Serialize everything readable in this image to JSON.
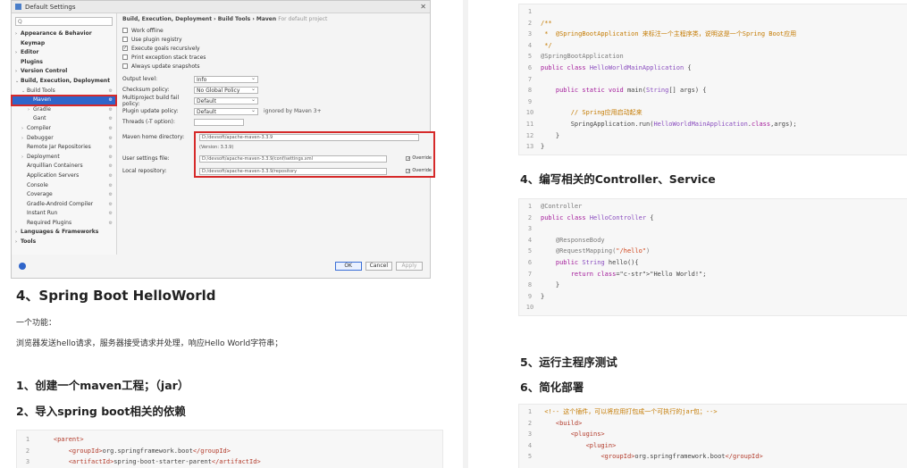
{
  "dialog": {
    "title": "Default Settings",
    "search_placeholder": "Q",
    "tree": [
      {
        "label": "Appearance & Behavior",
        "arrow": "›",
        "bold": true,
        "indent": 0
      },
      {
        "label": "Keymap",
        "arrow": "",
        "bold": true,
        "indent": 0
      },
      {
        "label": "Editor",
        "arrow": "›",
        "bold": true,
        "indent": 0
      },
      {
        "label": "Plugins",
        "arrow": "",
        "bold": true,
        "indent": 0
      },
      {
        "label": "Version Control",
        "arrow": "›",
        "bold": true,
        "indent": 0
      },
      {
        "label": "Build, Execution, Deployment",
        "arrow": "⌄",
        "bold": true,
        "indent": 0
      },
      {
        "label": "Build Tools",
        "arrow": "⌄",
        "bold": false,
        "indent": 1
      },
      {
        "label": "Maven",
        "arrow": "",
        "bold": false,
        "indent": 2,
        "selected": true
      },
      {
        "label": "Gradle",
        "arrow": "›",
        "bold": false,
        "indent": 2
      },
      {
        "label": "Gant",
        "arrow": "",
        "bold": false,
        "indent": 2
      },
      {
        "label": "Compiler",
        "arrow": "›",
        "bold": false,
        "indent": 1
      },
      {
        "label": "Debugger",
        "arrow": "›",
        "bold": false,
        "indent": 1
      },
      {
        "label": "Remote Jar Repositories",
        "arrow": "",
        "bold": false,
        "indent": 1
      },
      {
        "label": "Deployment",
        "arrow": "›",
        "bold": false,
        "indent": 1
      },
      {
        "label": "Arquillian Containers",
        "arrow": "",
        "bold": false,
        "indent": 1
      },
      {
        "label": "Application Servers",
        "arrow": "",
        "bold": false,
        "indent": 1
      },
      {
        "label": "Console",
        "arrow": "",
        "bold": false,
        "indent": 1
      },
      {
        "label": "Coverage",
        "arrow": "",
        "bold": false,
        "indent": 1
      },
      {
        "label": "Gradle-Android Compiler",
        "arrow": "",
        "bold": false,
        "indent": 1
      },
      {
        "label": "Instant Run",
        "arrow": "",
        "bold": false,
        "indent": 1
      },
      {
        "label": "Required Plugins",
        "arrow": "",
        "bold": false,
        "indent": 1
      },
      {
        "label": "Languages & Frameworks",
        "arrow": "›",
        "bold": true,
        "indent": 0
      },
      {
        "label": "Tools",
        "arrow": "›",
        "bold": true,
        "indent": 0
      }
    ],
    "breadcrumb": "Build, Execution, Deployment › Build Tools › Maven",
    "breadcrumb_hint": "For default project",
    "checkboxes": [
      {
        "label": "Work offline",
        "checked": false
      },
      {
        "label": "Use plugin registry",
        "checked": false
      },
      {
        "label": "Execute goals recursively",
        "checked": true
      },
      {
        "label": "Print exception stack traces",
        "checked": false
      },
      {
        "label": "Always update snapshots",
        "checked": false
      }
    ],
    "fields": [
      {
        "label": "Output level:",
        "value": "Info",
        "after": ""
      },
      {
        "label": "Checksum policy:",
        "value": "No Global Policy",
        "after": ""
      },
      {
        "label": "Multiproject build fail policy:",
        "value": "Default",
        "after": ""
      },
      {
        "label": "Plugin update policy:",
        "value": "Default",
        "after": "ignored by Maven 3+"
      }
    ],
    "threads_label": "Threads (-T option):",
    "maven_home_label": "Maven home directory:",
    "maven_home_value": "D:/devsoft/apache-maven-3.3.9",
    "maven_version": "(Version: 3.3.9)",
    "user_settings_label": "User settings file:",
    "user_settings_value": "D:/devsoft/apache-maven-3.3.9/conf/settings.xml",
    "local_repo_label": "Local repository:",
    "local_repo_value": "D:/devsoft/apache-maven-3.3.9/repository",
    "override_label": "Override",
    "ok_label": "OK",
    "cancel_label": "Cancel",
    "apply_label": "Apply"
  },
  "left": {
    "heading": "4、Spring Boot HelloWorld",
    "para1": "一个功能：",
    "para2": "浏览器发送hello请求，服务器接受请求并处理，响应Hello World字符串；",
    "step1": "1、创建一个maven工程；（jar）",
    "step2": "2、导入spring boot相关的依赖",
    "code_lines": [
      {
        "n": "1",
        "t": "    <parent>"
      },
      {
        "n": "2",
        "t": "        <groupId>org.springframework.boot</groupId>"
      },
      {
        "n": "3",
        "t": "        <artifactId>spring-boot-starter-parent</artifactId>"
      }
    ]
  },
  "right": {
    "code1": [
      {
        "n": "1",
        "t": ""
      },
      {
        "n": "2",
        "t": "/**"
      },
      {
        "n": "3",
        "t": " *  @SpringBootApplication 来标注一个主程序类，说明这是一个Spring Boot应用"
      },
      {
        "n": "4",
        "t": " */"
      },
      {
        "n": "5",
        "t": "@SpringBootApplication"
      },
      {
        "n": "6",
        "t": "public class HelloWorldMainApplication {"
      },
      {
        "n": "7",
        "t": ""
      },
      {
        "n": "8",
        "t": "    public static void main(String[] args) {"
      },
      {
        "n": "9",
        "t": ""
      },
      {
        "n": "10",
        "t": "        // Spring应用启动起来"
      },
      {
        "n": "11",
        "t": "        SpringApplication.run(HelloWorldMainApplication.class,args);"
      },
      {
        "n": "12",
        "t": "    }"
      },
      {
        "n": "13",
        "t": "}"
      }
    ],
    "heading4": "4、编写相关的Controller、Service",
    "code2": [
      {
        "n": "1",
        "t": "@Controller"
      },
      {
        "n": "2",
        "t": "public class HelloController {"
      },
      {
        "n": "3",
        "t": ""
      },
      {
        "n": "4",
        "t": "    @ResponseBody"
      },
      {
        "n": "5",
        "t": "    @RequestMapping(\"/hello\")"
      },
      {
        "n": "6",
        "t": "    public String hello(){"
      },
      {
        "n": "7",
        "t": "        return \"Hello World!\";"
      },
      {
        "n": "8",
        "t": "    }"
      },
      {
        "n": "9",
        "t": "}"
      },
      {
        "n": "10",
        "t": ""
      }
    ],
    "heading5": "5、运行主程序测试",
    "heading6": "6、简化部署",
    "code3": [
      {
        "n": "1",
        "t": " <!-- 这个插件，可以将应用打包成一个可执行的jar包；-->"
      },
      {
        "n": "2",
        "t": "    <build>"
      },
      {
        "n": "3",
        "t": "        <plugins>"
      },
      {
        "n": "4",
        "t": "            <plugin>"
      },
      {
        "n": "5",
        "t": "                <groupId>org.springframework.boot</groupId>"
      }
    ]
  }
}
